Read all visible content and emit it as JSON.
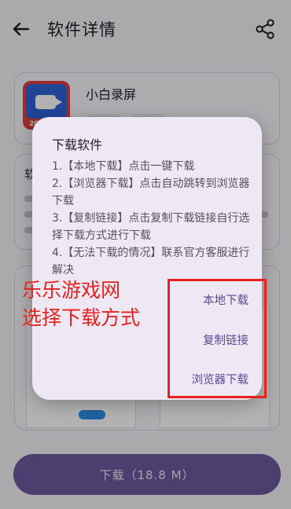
{
  "header": {
    "title": "软件详情"
  },
  "app": {
    "name": "小白录屏",
    "icon_year": "2023"
  },
  "info": {
    "heading_fragment": "软"
  },
  "footer": {
    "download_label": "下载（18.8 M）"
  },
  "dialog": {
    "title": "下载软件",
    "steps": [
      "1.【本地下载】点击一键下载",
      "2.【浏览器下载】点击自动跳转到浏览器下载",
      "3.【复制链接】点击复制下载链接自行选择下载方式进行下载",
      "4.【无法下载的情况】联系官方客服进行解决"
    ],
    "options": [
      "本地下载",
      "复制链接",
      "浏览器下载"
    ]
  },
  "annotation": {
    "line1": "乐乐游戏网",
    "line2": "选择下载方式"
  },
  "colors": {
    "accent": "#6e5aa0",
    "dialog_bg": "#ede8f4",
    "option_text": "#5b4a98",
    "annotation_red": "#e8211c"
  }
}
